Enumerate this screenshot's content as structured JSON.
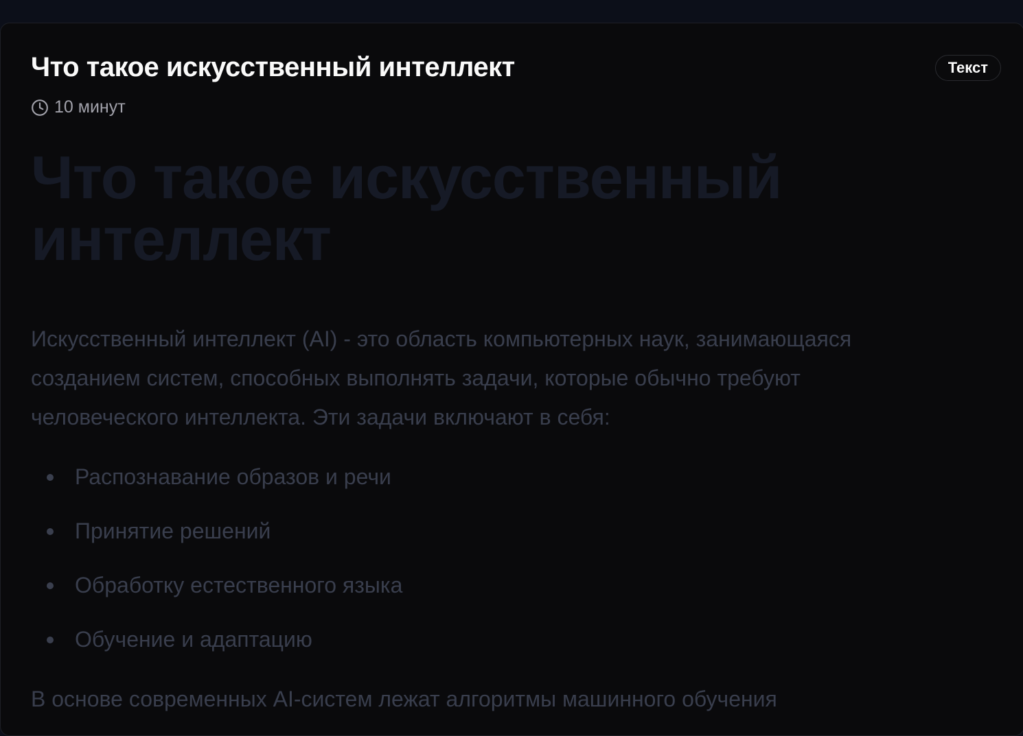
{
  "header": {
    "title": "Что такое искусственный интеллект",
    "duration": "10 минут",
    "badge": "Текст"
  },
  "article": {
    "heading": "Что такое искусственный интеллект",
    "intro": "Искусственный интеллект (AI) - это область компьютерных наук, занимающаяся созданием систем, способных выполнять задачи, которые обычно требуют человеческого интеллекта. Эти задачи включают в себя:",
    "items": [
      "Распознавание образов и речи",
      "Принятие решений",
      "Обработку естественного языка",
      "Обучение и адаптацию"
    ],
    "next": "В основе современных AI-систем лежат алгоритмы машинного обучения"
  }
}
